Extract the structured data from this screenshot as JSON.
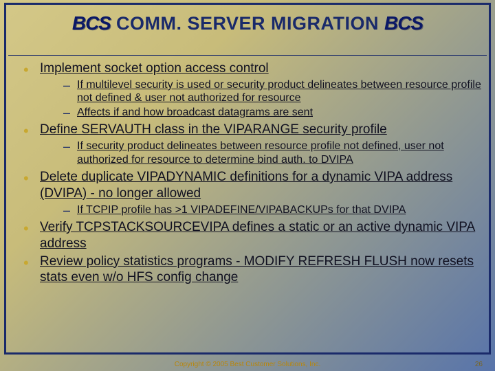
{
  "header": {
    "logo_text": "BCS",
    "title": "COMM. SERVER MIGRATION"
  },
  "bullets": [
    {
      "text": "Implement socket option access control",
      "subs": [
        {
          "prefix": "If multilevel security is used or ",
          "rest": "security product delineates between resource profile not defined & user not authorized for resource"
        },
        {
          "prefix": "",
          "rest": "Affects if and how broadcast datagrams are sent"
        }
      ]
    },
    {
      "text": "Define SERVAUTH class in the VIPARANGE security profile",
      "subs": [
        {
          "prefix": "If ",
          "rest": "security product delineates between resource profile not defined, user not authorized for resource to determine bind auth. to DVIPA"
        }
      ]
    },
    {
      "text": "Delete duplicate VIPADYNAMIC definitions for a dynamic VIPA address (DVIPA) - no longer allowed",
      "subs": [
        {
          "prefix": "",
          "rest": "If TCPIP profile has >1 VIPADEFINE/VIPABACKUPs for that DVIPA"
        }
      ]
    },
    {
      "text": "Verify TCPSTACKSOURCEVIPA defines a static or an active dynamic VIPA address",
      "subs": []
    },
    {
      "text": "Review policy statistics programs - MODIFY REFRESH FLUSH now resets stats even w/o HFS config change",
      "subs": []
    }
  ],
  "footer": {
    "copyright": "Copyright © 2005 Best Customer Solutions, Inc.",
    "page": "26"
  }
}
